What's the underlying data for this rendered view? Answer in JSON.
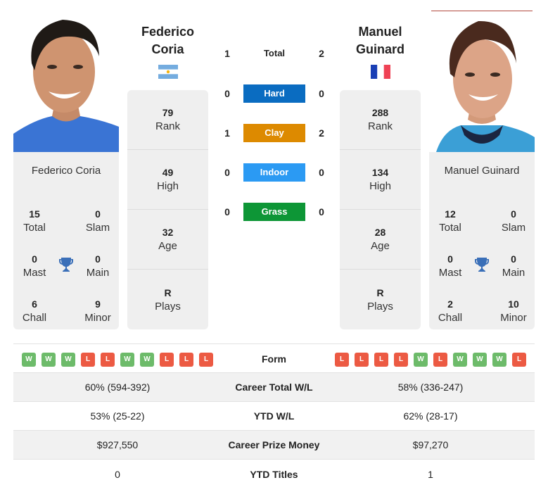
{
  "h2h": {
    "total": {
      "label": "Total",
      "left": "1",
      "right": "2"
    },
    "surfaces": [
      {
        "label": "Hard",
        "left": "0",
        "right": "0",
        "color": "#0a6cc1"
      },
      {
        "label": "Clay",
        "left": "1",
        "right": "2",
        "color": "#dd8a00"
      },
      {
        "label": "Indoor",
        "left": "0",
        "right": "0",
        "color": "#2b9af3"
      },
      {
        "label": "Grass",
        "left": "0",
        "right": "0",
        "color": "#0d9636"
      }
    ]
  },
  "players": {
    "left": {
      "name": "Federico Coria",
      "name_line1": "Federico",
      "name_line2": "Coria",
      "flag": "argentina-flag",
      "stats": [
        {
          "value": "79",
          "label": "Rank"
        },
        {
          "value": "49",
          "label": "High"
        },
        {
          "value": "32",
          "label": "Age"
        },
        {
          "value": "R",
          "label": "Plays"
        }
      ],
      "titles": {
        "total": {
          "value": "15",
          "label": "Total"
        },
        "slam": {
          "value": "0",
          "label": "Slam"
        },
        "mast": {
          "value": "0",
          "label": "Mast"
        },
        "main": {
          "value": "0",
          "label": "Main"
        },
        "chall": {
          "value": "6",
          "label": "Chall"
        },
        "minor": {
          "value": "9",
          "label": "Minor"
        }
      },
      "form": [
        "W",
        "W",
        "W",
        "L",
        "L",
        "W",
        "W",
        "L",
        "L",
        "L"
      ]
    },
    "right": {
      "name": "Manuel Guinard",
      "name_line1": "Manuel",
      "name_line2": "Guinard",
      "flag": "france-flag",
      "stats": [
        {
          "value": "288",
          "label": "Rank"
        },
        {
          "value": "134",
          "label": "High"
        },
        {
          "value": "28",
          "label": "Age"
        },
        {
          "value": "R",
          "label": "Plays"
        }
      ],
      "titles": {
        "total": {
          "value": "12",
          "label": "Total"
        },
        "slam": {
          "value": "0",
          "label": "Slam"
        },
        "mast": {
          "value": "0",
          "label": "Mast"
        },
        "main": {
          "value": "0",
          "label": "Main"
        },
        "chall": {
          "value": "2",
          "label": "Chall"
        },
        "minor": {
          "value": "10",
          "label": "Minor"
        }
      },
      "form": [
        "L",
        "L",
        "L",
        "L",
        "W",
        "L",
        "W",
        "W",
        "W",
        "L"
      ]
    }
  },
  "form_label": "Form",
  "comparison": [
    {
      "label": "Career Total W/L",
      "left": "60% (594-392)",
      "right": "58% (336-247)"
    },
    {
      "label": "YTD W/L",
      "left": "53% (25-22)",
      "right": "62% (28-17)"
    },
    {
      "label": "Career Prize Money",
      "left": "$927,550",
      "right": "$97,270"
    },
    {
      "label": "YTD Titles",
      "left": "0",
      "right": "1"
    }
  ],
  "colors": {
    "win": "#6dbb6a",
    "loss": "#ec5a43",
    "trophy": "#3a6fb8",
    "panel": "#efefef"
  }
}
